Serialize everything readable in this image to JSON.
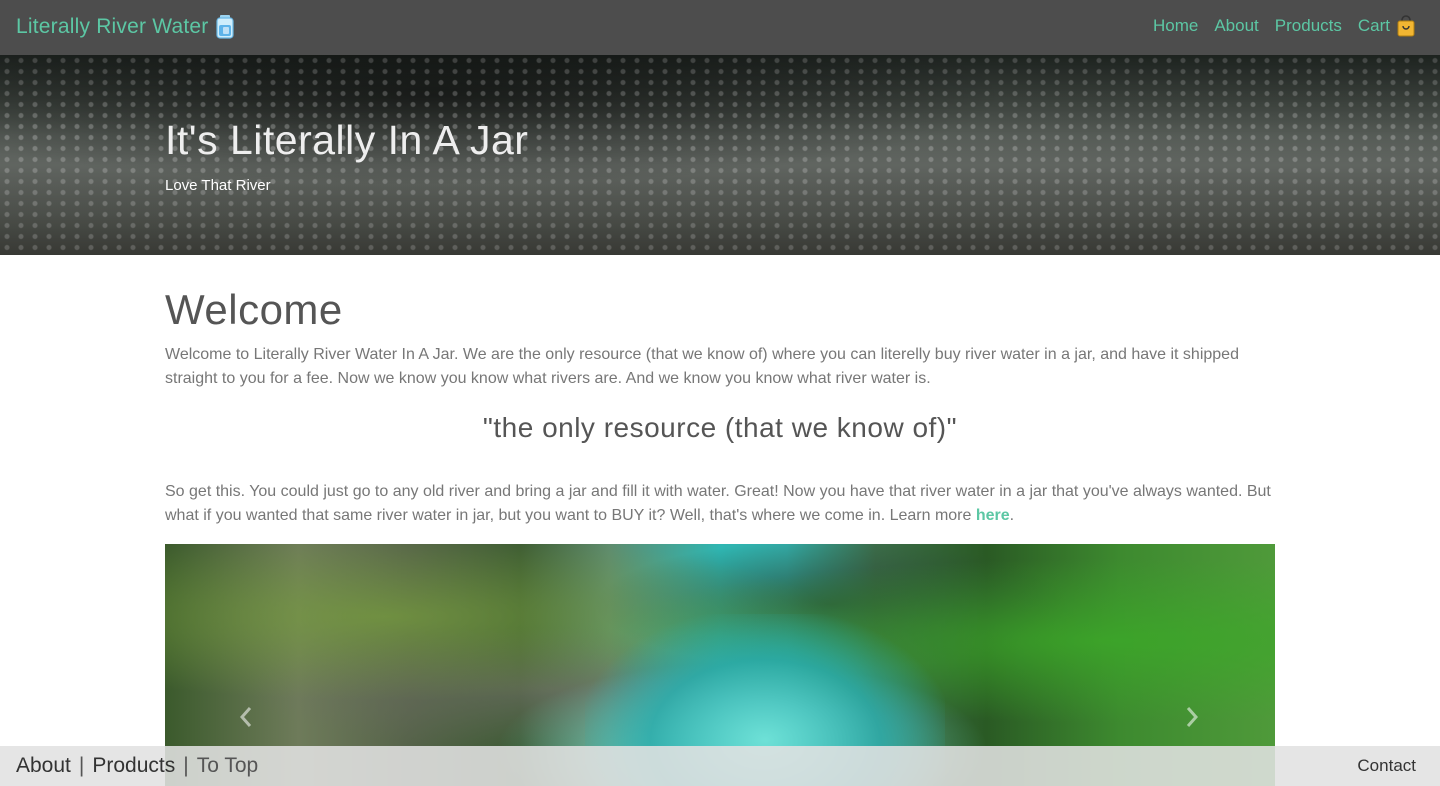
{
  "navbar": {
    "brand": "Literally River Water",
    "brand_icon": "water-jar-icon",
    "links": [
      {
        "label": "Home"
      },
      {
        "label": "About"
      },
      {
        "label": "Products"
      },
      {
        "label": "Cart",
        "icon": "shopping-bag-icon"
      }
    ],
    "accent_color": "#5cc7a4"
  },
  "hero": {
    "title": "It's Literally In A Jar",
    "subtitle": "Love That River"
  },
  "main": {
    "heading": "Welcome",
    "paragraph1": "Welcome to Literally River Water In A Jar. We are the only resource (that we know of) where you can literelly buy river water in a jar, and have it shipped straight to you for a fee. Now we know you know what rivers are. And we know you know what river water is.",
    "quote": "\"the only resource (that we know of)\"",
    "paragraph2": "So get this. You could just go to any old river and bring a jar and fill it with water. Great! Now you have that river water in a jar that you've always wanted. But what if you wanted that same river water in jar, but you want to BUY it? Well, that's where we come in. Learn more ",
    "paragraph2_link": "here",
    "paragraph2_end": "."
  },
  "carousel": {
    "prev_icon": "chevron-left-icon",
    "next_icon": "chevron-right-icon"
  },
  "footer": {
    "about": "About",
    "products": "Products",
    "to_top": "To Top",
    "separator": "|",
    "contact": "Contact"
  }
}
